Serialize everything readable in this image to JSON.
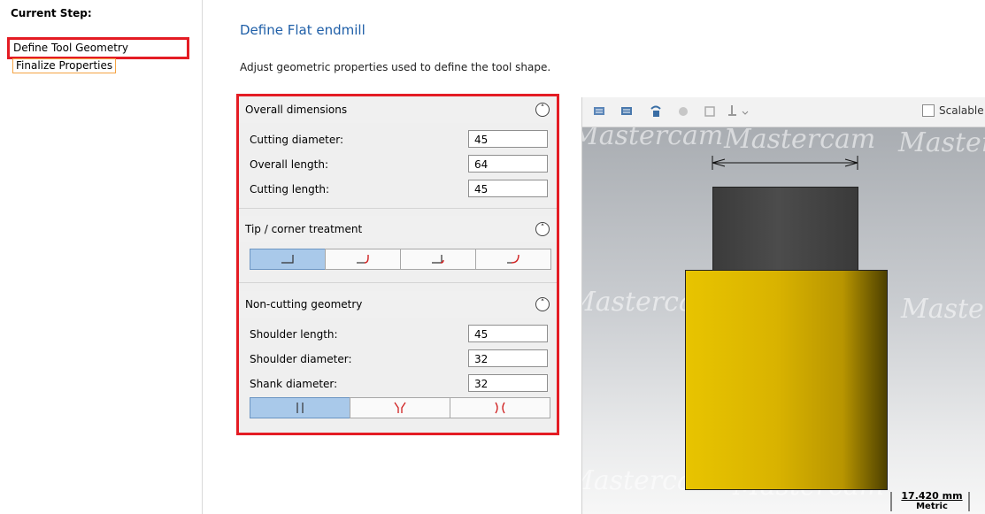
{
  "steps": {
    "title": "Current Step:",
    "items": [
      {
        "label": "Define Tool Geometry"
      },
      {
        "label": "Finalize Properties"
      }
    ]
  },
  "main": {
    "title": "Define Flat endmill",
    "description": "Adjust geometric properties used to define the tool shape."
  },
  "overall": {
    "header": "Overall dimensions",
    "fields": [
      {
        "label": "Cutting diameter:",
        "value": "45"
      },
      {
        "label": "Overall length:",
        "value": "64"
      },
      {
        "label": "Cutting length:",
        "value": "45"
      }
    ]
  },
  "tip": {
    "header": "Tip / corner treatment",
    "buttons": [
      "flat-corner-icon",
      "corner-radius-icon",
      "corner-radius-small-icon",
      "full-radius-icon"
    ],
    "selected": 0
  },
  "noncutting": {
    "header": "Non-cutting geometry",
    "fields": [
      {
        "label": "Shoulder length:",
        "value": "45"
      },
      {
        "label": "Shoulder diameter:",
        "value": "32"
      },
      {
        "label": "Shank diameter:",
        "value": "32"
      }
    ],
    "buttons": [
      "straight-shank-icon",
      "tapered-shank-icon",
      "necked-shank-icon"
    ],
    "selected": 0
  },
  "viewport": {
    "scalable_label": "Scalable",
    "scalable_checked": false,
    "watermark": "Mastercam",
    "scale_value": "17.420 mm",
    "scale_unit": "Metric",
    "colors": {
      "cutting": "#d9b300",
      "shank": "#444444",
      "accent": "#e41c24"
    }
  }
}
